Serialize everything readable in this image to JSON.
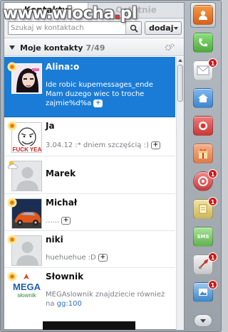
{
  "watermark": {
    "text_a": "www.wiocha",
    "dot": ".",
    "text_b": "pl"
  },
  "tabs": [
    {
      "label": "Kontakty",
      "active": true
    },
    {
      "label": "Ostatnie",
      "active": false
    }
  ],
  "search": {
    "placeholder": "Szukaj w kontaktach",
    "value": ""
  },
  "add_button": {
    "label": "dodaj"
  },
  "group": {
    "title": "Moje kontakty",
    "count": "7/49"
  },
  "contacts": [
    {
      "name": "Alina:o",
      "desc": "Ide robic kupemessages_ende Mam duzego wiec to troche zajmie%d%a",
      "status": "sun-icon",
      "selected": true,
      "avatar": "girl-photo"
    },
    {
      "name": "Ja",
      "desc": "3.04.12 :* dniem szczęścią :)",
      "status": "sun-icon",
      "selected": false,
      "avatar": "fuck-yea-meme"
    },
    {
      "name": "Marek",
      "desc": "",
      "status": "cloud-icon",
      "selected": false,
      "avatar": "default-avatar"
    },
    {
      "name": "Michał",
      "desc": "......",
      "status": "sun-icon",
      "selected": false,
      "avatar": "car-photo"
    },
    {
      "name": "niki",
      "desc": "huehuehue :D",
      "status": "sun-icon",
      "selected": false,
      "avatar": "default-avatar"
    },
    {
      "name": "Słownik",
      "desc": "MEGAslownik znajdziecie również na",
      "link": "gg:100",
      "status": "sun-icon",
      "selected": false,
      "avatar": "mega-slownik-logo"
    }
  ],
  "sidebar": {
    "items": [
      {
        "name": "contacts",
        "icon": "contacts-book-icon",
        "color": "#e8731c",
        "active": true,
        "badge": ""
      },
      {
        "name": "phone",
        "icon": "phone-icon",
        "color": "#67c25a",
        "active": false,
        "badge": ""
      },
      {
        "name": "mail",
        "icon": "mail-icon",
        "color": "#e8eaec",
        "active": false,
        "badge": "1"
      },
      {
        "name": "home",
        "icon": "home-icon",
        "color": "#5b9fe0",
        "active": false,
        "badge": ""
      },
      {
        "name": "record",
        "icon": "record-icon",
        "color": "#e04a4a",
        "active": false,
        "badge": ""
      },
      {
        "name": "gift",
        "icon": "gift-icon",
        "color": "#ef8a5a",
        "active": false,
        "badge": ""
      },
      {
        "name": "game",
        "icon": "game-icon",
        "color": "#e05050",
        "active": false,
        "badge": "1"
      },
      {
        "name": "notes",
        "icon": "notes-icon",
        "color": "#d6c36a",
        "active": false,
        "badge": "1"
      },
      {
        "name": "sms",
        "icon": "sms-icon",
        "color": "#7fcd6a",
        "active": false,
        "badge": ""
      },
      {
        "name": "tools",
        "icon": "tools-icon",
        "color": "#d9d9d9",
        "active": false,
        "badge": "1"
      },
      {
        "name": "gallery",
        "icon": "gallery-icon",
        "color": "#5ea0d8",
        "active": false,
        "badge": "1"
      }
    ],
    "sms_label": "SMS"
  }
}
